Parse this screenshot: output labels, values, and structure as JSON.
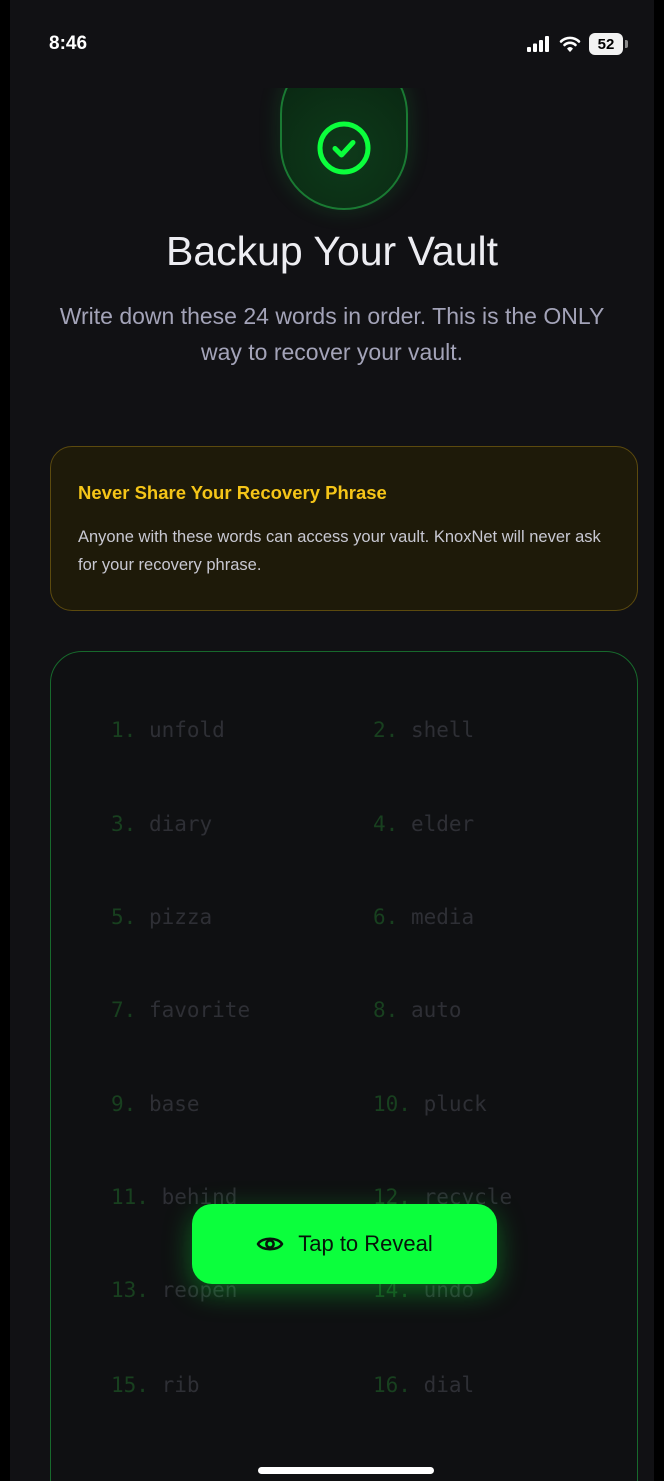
{
  "status_bar": {
    "time": "8:46",
    "battery": "52",
    "icons": [
      "signal-icon",
      "wifi-icon",
      "battery-icon"
    ]
  },
  "header": {
    "icon": "check-circle-icon",
    "title": "Backup Your Vault",
    "subtitle": "Write down these 24 words in order. This is the ONLY way to recover your vault."
  },
  "warning": {
    "title": "Never Share Your Recovery Phrase",
    "body": "Anyone with these words can access your vault. KnoxNet will never ask for your recovery phrase."
  },
  "phrase": {
    "words": [
      {
        "num": "1.",
        "word": "unfold"
      },
      {
        "num": "2.",
        "word": "shell"
      },
      {
        "num": "3.",
        "word": "diary"
      },
      {
        "num": "4.",
        "word": "elder"
      },
      {
        "num": "5.",
        "word": "pizza"
      },
      {
        "num": "6.",
        "word": "media"
      },
      {
        "num": "7.",
        "word": "favorite"
      },
      {
        "num": "8.",
        "word": "auto"
      },
      {
        "num": "9.",
        "word": "base"
      },
      {
        "num": "10.",
        "word": "pluck"
      },
      {
        "num": "11.",
        "word": "behind"
      },
      {
        "num": "12.",
        "word": "recycle"
      },
      {
        "num": "13.",
        "word": "reopen"
      },
      {
        "num": "14.",
        "word": "undo"
      },
      {
        "num": "15.",
        "word": "rib"
      },
      {
        "num": "16.",
        "word": "dial"
      }
    ]
  },
  "reveal_button": {
    "label": "Tap to Reveal",
    "icon": "eye-icon"
  },
  "colors": {
    "accent": "#0bff3c",
    "warning": "#f5c518",
    "background": "#111114"
  }
}
